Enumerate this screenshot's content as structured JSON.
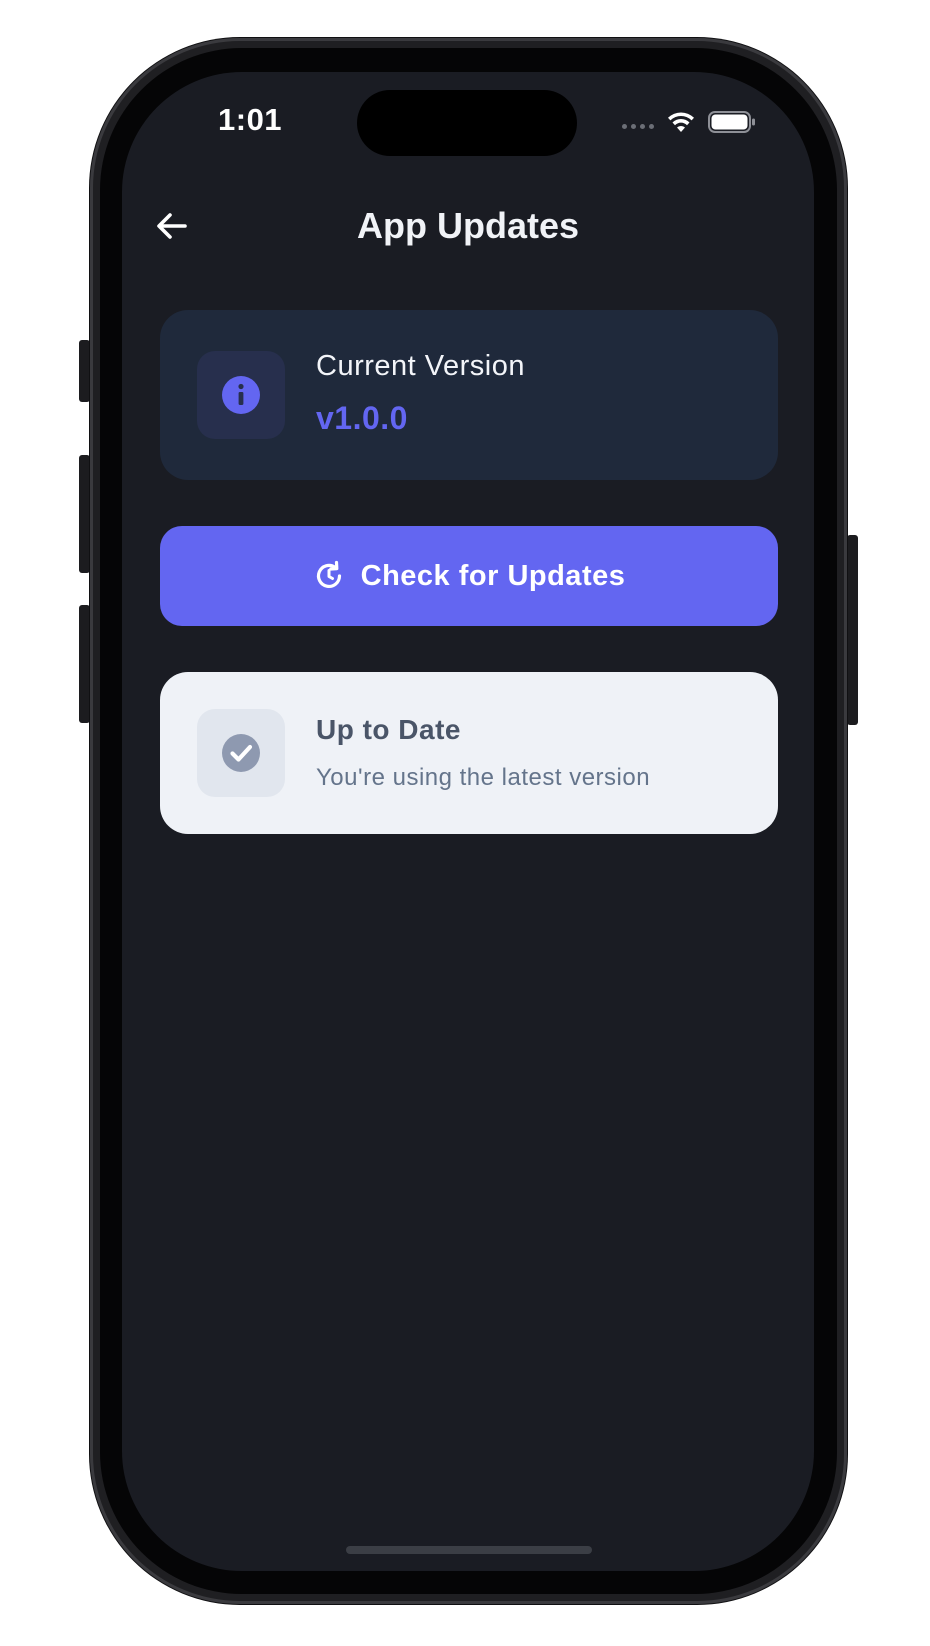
{
  "status_bar": {
    "time": "1:01"
  },
  "header": {
    "title": "App Updates",
    "back_icon": "arrow-left-icon"
  },
  "version_card": {
    "icon": "info-icon",
    "label": "Current Version",
    "value": "v1.0.0"
  },
  "check_button": {
    "icon": "refresh-clock-icon",
    "label": "Check for Updates"
  },
  "status_card": {
    "icon": "check-circle-icon",
    "title": "Up to Date",
    "description": "You're using the latest version"
  },
  "colors": {
    "background": "#1a1c23",
    "accent": "#6366f1",
    "card_dark": "#1f293b",
    "card_light": "#eff2f7"
  }
}
